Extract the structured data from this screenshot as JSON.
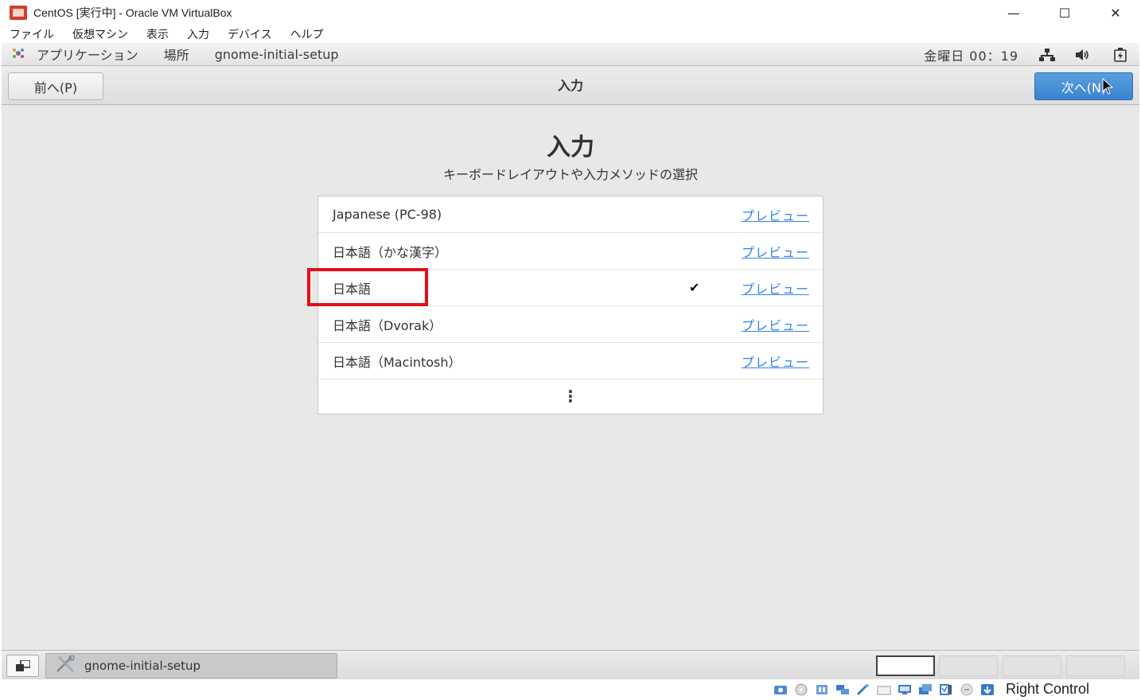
{
  "window": {
    "title": "CentOS [実行中] - Oracle VM VirtualBox",
    "controls": {
      "minimize": "—",
      "maximize": "☐",
      "close": "✕"
    }
  },
  "vbox_menu": [
    "ファイル",
    "仮想マシン",
    "表示",
    "入力",
    "デバイス",
    "ヘルプ"
  ],
  "gnome_top": {
    "applications": "アプリケーション",
    "places": "場所",
    "app_name": "gnome-initial-setup",
    "clock": "金曜日 00：19",
    "icons": [
      "network-icon",
      "volume-icon",
      "power-icon"
    ]
  },
  "header": {
    "prev_label": "前へ(P)",
    "title": "入力",
    "next_label": "次へ(N)"
  },
  "page": {
    "heading": "入力",
    "subtitle": "キーボードレイアウトや入力メソッドの選択"
  },
  "layouts": [
    {
      "label": "Japanese (PC-98)",
      "preview": "プレビュー",
      "selected": false
    },
    {
      "label": "日本語（かな漢字）",
      "preview": "プレビュー",
      "selected": false
    },
    {
      "label": "日本語",
      "preview": "プレビュー",
      "selected": true,
      "check": "✔"
    },
    {
      "label": "日本語（Dvorak）",
      "preview": "プレビュー",
      "selected": false
    },
    {
      "label": "日本語（Macintosh）",
      "preview": "プレビュー",
      "selected": false
    }
  ],
  "more_glyph": "⋮",
  "gnome_bottom": {
    "task_label": "gnome-initial-setup",
    "workspaces": 4,
    "active_workspace": 1
  },
  "statusbar": {
    "host_key": "Right Control"
  },
  "colors": {
    "accent": "#3584e4",
    "highlight": "#e0101a",
    "next_button": "#3a84cf"
  }
}
